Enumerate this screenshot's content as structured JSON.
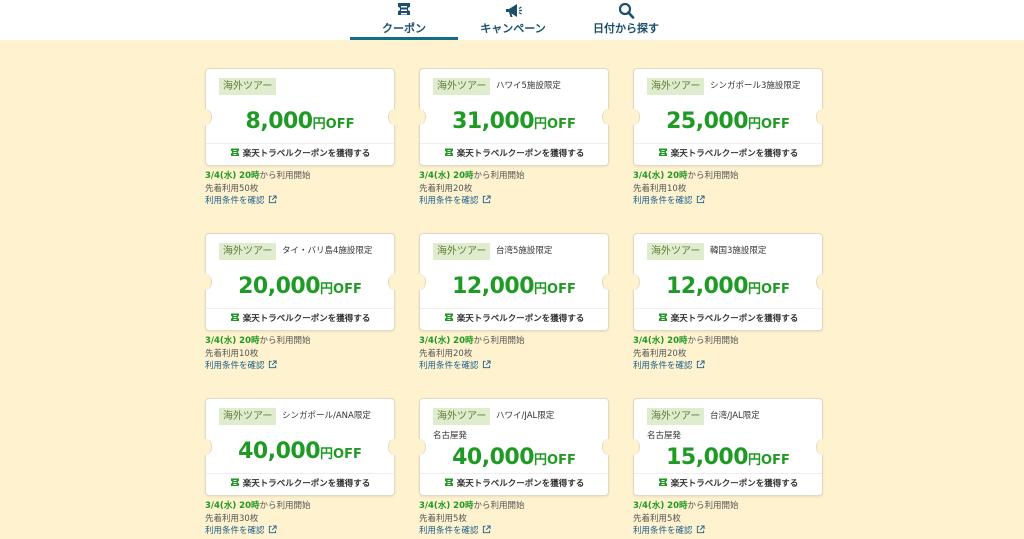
{
  "tabs": [
    {
      "label": "クーポン",
      "icon": "ticket-icon",
      "active": true
    },
    {
      "label": "キャンペーン",
      "icon": "megaphone-icon",
      "active": false
    },
    {
      "label": "日付から探す",
      "icon": "search-icon",
      "active": false
    }
  ],
  "colors": {
    "accent": "#1f9a24",
    "chip_bg": "#dfeccd",
    "page_bg": "#fef2cf",
    "tab_underline": "#0d6e86"
  },
  "coupons": [
    {
      "chip": "海外ツアー",
      "label": "",
      "sub": "",
      "amount": "8,000",
      "yen": "円",
      "off": "OFF",
      "cta": "楽天トラベルクーポンを獲得する",
      "start_date": "3/4(水) 20時",
      "start_text": "から利用開始",
      "limit": "先着利用50枚",
      "terms": "利用条件を確認"
    },
    {
      "chip": "海外ツアー",
      "label": "ハワイ5施設限定",
      "sub": "",
      "amount": "31,000",
      "yen": "円",
      "off": "OFF",
      "cta": "楽天トラベルクーポンを獲得する",
      "start_date": "3/4(水) 20時",
      "start_text": "から利用開始",
      "limit": "先着利用20枚",
      "terms": "利用条件を確認"
    },
    {
      "chip": "海外ツアー",
      "label": "シンガポール3施設限定",
      "sub": "",
      "amount": "25,000",
      "yen": "円",
      "off": "OFF",
      "cta": "楽天トラベルクーポンを獲得する",
      "start_date": "3/4(水) 20時",
      "start_text": "から利用開始",
      "limit": "先着利用10枚",
      "terms": "利用条件を確認"
    },
    {
      "chip": "海外ツアー",
      "label": "タイ・バリ島4施設限定",
      "sub": "",
      "amount": "20,000",
      "yen": "円",
      "off": "OFF",
      "cta": "楽天トラベルクーポンを獲得する",
      "start_date": "3/4(水) 20時",
      "start_text": "から利用開始",
      "limit": "先着利用10枚",
      "terms": "利用条件を確認"
    },
    {
      "chip": "海外ツアー",
      "label": "台湾5施設限定",
      "sub": "",
      "amount": "12,000",
      "yen": "円",
      "off": "OFF",
      "cta": "楽天トラベルクーポンを獲得する",
      "start_date": "3/4(水) 20時",
      "start_text": "から利用開始",
      "limit": "先着利用20枚",
      "terms": "利用条件を確認"
    },
    {
      "chip": "海外ツアー",
      "label": "韓国3施設限定",
      "sub": "",
      "amount": "12,000",
      "yen": "円",
      "off": "OFF",
      "cta": "楽天トラベルクーポンを獲得する",
      "start_date": "3/4(水) 20時",
      "start_text": "から利用開始",
      "limit": "先着利用20枚",
      "terms": "利用条件を確認"
    },
    {
      "chip": "海外ツアー",
      "label": "シンガポール/ANA限定",
      "sub": "",
      "amount": "40,000",
      "yen": "円",
      "off": "OFF",
      "cta": "楽天トラベルクーポンを獲得する",
      "start_date": "3/4(水) 20時",
      "start_text": "から利用開始",
      "limit": "先着利用30枚",
      "terms": "利用条件を確認"
    },
    {
      "chip": "海外ツアー",
      "label": "ハワイ/JAL限定",
      "sub": "名古屋発",
      "amount": "40,000",
      "yen": "円",
      "off": "OFF",
      "cta": "楽天トラベルクーポンを獲得する",
      "start_date": "3/4(水) 20時",
      "start_text": "から利用開始",
      "limit": "先着利用5枚",
      "terms": "利用条件を確認"
    },
    {
      "chip": "海外ツアー",
      "label": "台湾/JAL限定",
      "sub": "名古屋発",
      "amount": "15,000",
      "yen": "円",
      "off": "OFF",
      "cta": "楽天トラベルクーポンを獲得する",
      "start_date": "3/4(水) 20時",
      "start_text": "から利用開始",
      "limit": "先着利用5枚",
      "terms": "利用条件を確認"
    }
  ]
}
